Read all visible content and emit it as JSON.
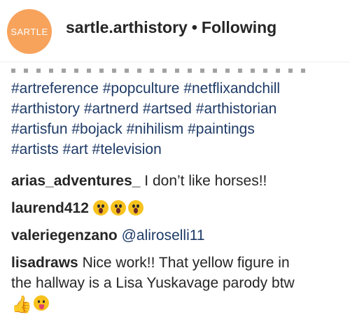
{
  "colors": {
    "avatar_bg": "#f7a35c",
    "hashtag": "#1e3a66"
  },
  "header": {
    "avatar_text": "SARTLE",
    "username": "sartle.arthistory",
    "separator": "•",
    "follow_status": "Following"
  },
  "caption": {
    "hashtag_lines": [
      "#artreference #popculture #netflixandchill",
      "#arthistory #artnerd #artsed #arthistorian",
      "#artisfun #bojack #nihilism #paintings",
      "#artists #art #television"
    ]
  },
  "comments": [
    {
      "user": "arias_adventures_",
      "text": "I don’t like horses!!"
    },
    {
      "user": "laurend412",
      "emoji": [
        "face-screaming-in-fear",
        "face-screaming-in-fear",
        "face-screaming-in-fear"
      ]
    },
    {
      "user": "valeriegenzano",
      "mention": "@aliroselli11"
    },
    {
      "user": "lisadraws",
      "text_line1": "Nice work!! That yellow figure in",
      "text_line2": "the hallway is a Lisa Yuskavage parody btw",
      "emoji": [
        "thumbs-up",
        "face-with-tongue"
      ]
    }
  ]
}
